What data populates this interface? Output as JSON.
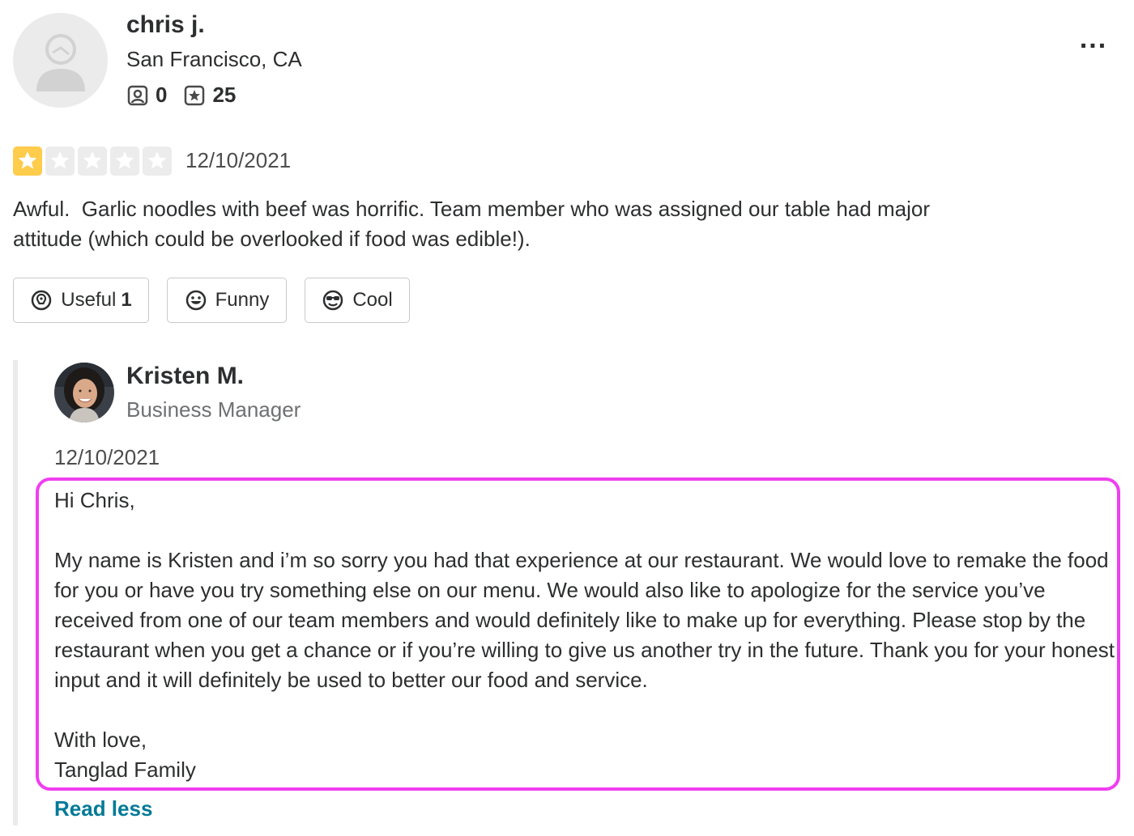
{
  "reviewer": {
    "name": "chris j.",
    "location": "San Francisco, CA",
    "friends_count": "0",
    "reviews_count": "25",
    "avatar_icon": "default-user-avatar-icon"
  },
  "more_menu_label": "...",
  "review": {
    "rating": 1,
    "rating_max": 5,
    "star_color": "#ffcc4b",
    "date": "12/10/2021",
    "text": "Awful.  Garlic noodles with beef was horrific. Team member who was assigned our table had major\nattitude (which could be overlooked if food was edible!)."
  },
  "reactions": {
    "useful_label": "Useful",
    "useful_count": "1",
    "funny_label": "Funny",
    "cool_label": "Cool"
  },
  "owner_reply": {
    "name": "Kristen M.",
    "role": "Business Manager",
    "date": "12/10/2021",
    "greeting": "Hi Chris,",
    "body": "My name is Kristen and i’m so sorry you had that experience at our restaurant. We would love to remake the food for you or have you try something else on our menu. We would also like to apologize for the service you’ve received from one of our team members and would definitely like to make up for everything. Please stop by the restaurant when you get a chance or if you’re willing to give us another try in the future. Thank you for your honest input and it will definitely be used to better our food and service.",
    "closing": "With love,",
    "signature": "Tanglad Family",
    "highlight_color": "#f03ef0"
  },
  "read_less_label": "Read less"
}
